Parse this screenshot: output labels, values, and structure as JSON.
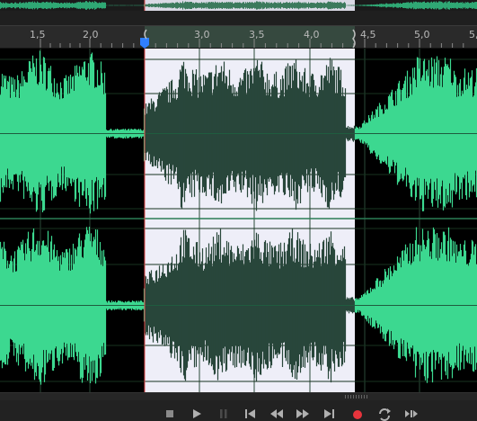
{
  "ruler": {
    "ticks": [
      {
        "label": "1,5"
      },
      {
        "label": "2,0"
      },
      {
        "label": "3,0"
      },
      {
        "label": "3,5"
      },
      {
        "label": "4,0"
      },
      {
        "label": "4,5"
      },
      {
        "label": "5,0"
      },
      {
        "label": "5,"
      }
    ]
  },
  "colors": {
    "waveform": "#3cd890",
    "selection_background": "#eeeef8",
    "selection_waveform": "#29473b",
    "playhead": "#2f7fff",
    "record": "#e8343c"
  },
  "transport": {
    "buttons": [
      {
        "name": "stop-button",
        "icon": "stop-icon"
      },
      {
        "name": "play-button",
        "icon": "play-icon"
      },
      {
        "name": "pause-button",
        "icon": "pause-icon"
      },
      {
        "name": "skip-to-start-button",
        "icon": "skip-back-icon"
      },
      {
        "name": "rewind-button",
        "icon": "rewind-icon"
      },
      {
        "name": "fast-forward-button",
        "icon": "fast-forward-icon"
      },
      {
        "name": "skip-to-end-button",
        "icon": "skip-forward-icon"
      },
      {
        "name": "record-button",
        "icon": "record-icon"
      },
      {
        "name": "loop-button",
        "icon": "loop-icon"
      },
      {
        "name": "skip-selection-button",
        "icon": "skip-selection-icon"
      }
    ]
  }
}
